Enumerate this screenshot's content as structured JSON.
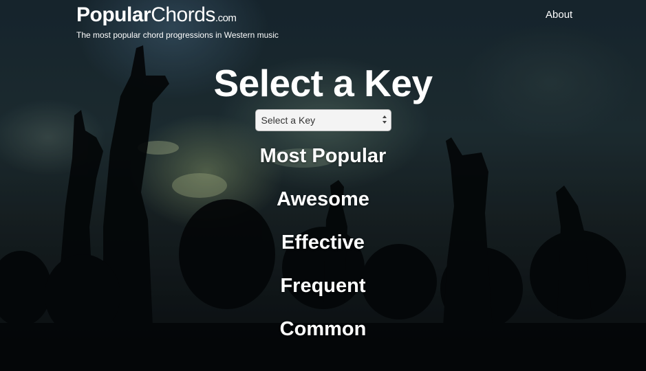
{
  "header": {
    "brand_bold": "Popular",
    "brand_regular": "Chords",
    "brand_suffix": ".com",
    "tagline": "The most popular chord progressions in Western music",
    "about_link": "About"
  },
  "main": {
    "title": "Select a Key",
    "key_select": {
      "selected": "Select a Key"
    },
    "categories": [
      "Most Popular",
      "Awesome",
      "Effective",
      "Frequent",
      "Common"
    ]
  },
  "colors": {
    "text": "#ffffff",
    "select_background": "#f4f4f4",
    "select_text": "#333333"
  },
  "icons": {
    "select_arrows": "up-down-chevron-icon"
  }
}
